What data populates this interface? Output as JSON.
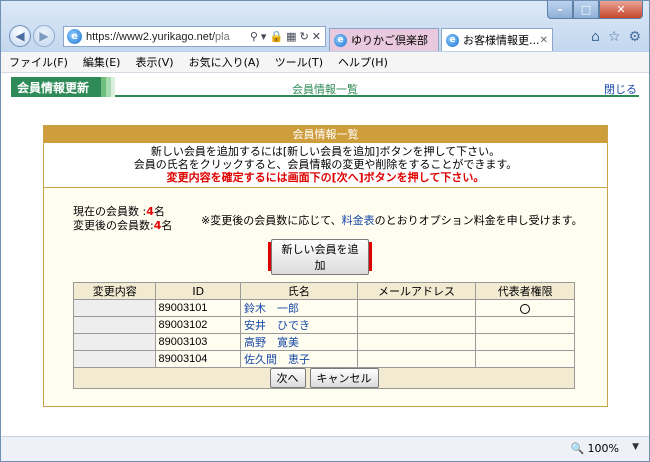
{
  "browser": {
    "address": {
      "main": "https://www2.yurikago.net/",
      "tail": "pla"
    },
    "tabs": [
      {
        "label": "ゆりかご倶楽部"
      },
      {
        "label": "お客様情報更..."
      }
    ],
    "menu": [
      "ファイル(F)",
      "編集(E)",
      "表示(V)",
      "お気に入り(A)",
      "ツール(T)",
      "ヘルプ(H)"
    ],
    "zoom": "100%"
  },
  "app": {
    "section_title": "会員情報更新",
    "page_title": "会員情報一覧",
    "close_link": "閉じる"
  },
  "panel": {
    "title": "会員情報一覧",
    "desc_line1": "新しい会員を追加するには[新しい会員を追加]ボタンを押して下さい。",
    "desc_line2": "会員の氏名をクリックすると、会員情報の変更や削除をすることができます。",
    "desc_line3": "変更内容を確定するには画面下の[次へ]ボタンを押して下さい。",
    "current_label": "現在の会員数",
    "current_count": "4",
    "after_label": "変更後の会員数",
    "after_count": "4",
    "count_unit": "名",
    "note_prefix": "※変更後の会員数に応じて、",
    "note_link": "料金表",
    "note_suffix": "のとおりオプション料金を申し受けます。",
    "add_button": "新しい会員を追加"
  },
  "table": {
    "headers": [
      "変更内容",
      "ID",
      "氏名",
      "メールアドレス",
      "代表者権限"
    ],
    "rows": [
      {
        "change": "",
        "id": "89003101",
        "name": "鈴木　一郎",
        "email": "",
        "representative": "○"
      },
      {
        "change": "",
        "id": "89003102",
        "name": "安井　ひでき",
        "email": "",
        "representative": ""
      },
      {
        "change": "",
        "id": "89003103",
        "name": "高野　寛美",
        "email": "",
        "representative": ""
      },
      {
        "change": "",
        "id": "89003104",
        "name": "佐久間　恵子",
        "email": "",
        "representative": ""
      }
    ],
    "next_button": "次へ",
    "cancel_button": "キャンセル"
  }
}
